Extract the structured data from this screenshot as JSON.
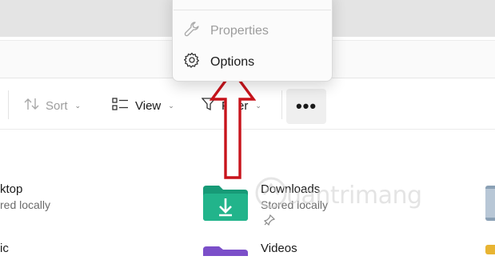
{
  "context_menu": {
    "items": [
      {
        "label": "Properties",
        "icon": "wrench-icon",
        "enabled": false
      },
      {
        "label": "Options",
        "icon": "gear-icon",
        "enabled": true
      }
    ]
  },
  "toolbar": {
    "sort_label": "Sort",
    "view_label": "View",
    "filter_label": "Filter",
    "more_label": "•••"
  },
  "files": [
    {
      "name": "ktop",
      "status": "red locally",
      "icon": "desktop-folder-icon"
    },
    {
      "name": "Downloads",
      "status": "Stored locally",
      "icon": "downloads-folder-icon",
      "pinned": true
    },
    {
      "name": "ic",
      "status": "",
      "icon": "music-folder-icon"
    },
    {
      "name": "Videos",
      "status": "",
      "icon": "videos-folder-icon"
    }
  ],
  "watermark": {
    "text": "uantrimang"
  },
  "colors": {
    "annotation_arrow": "#c8141c",
    "downloads_folder": "#1fa884",
    "videos_folder": "#7b4fc9",
    "disabled_text": "#9c9c9c"
  }
}
